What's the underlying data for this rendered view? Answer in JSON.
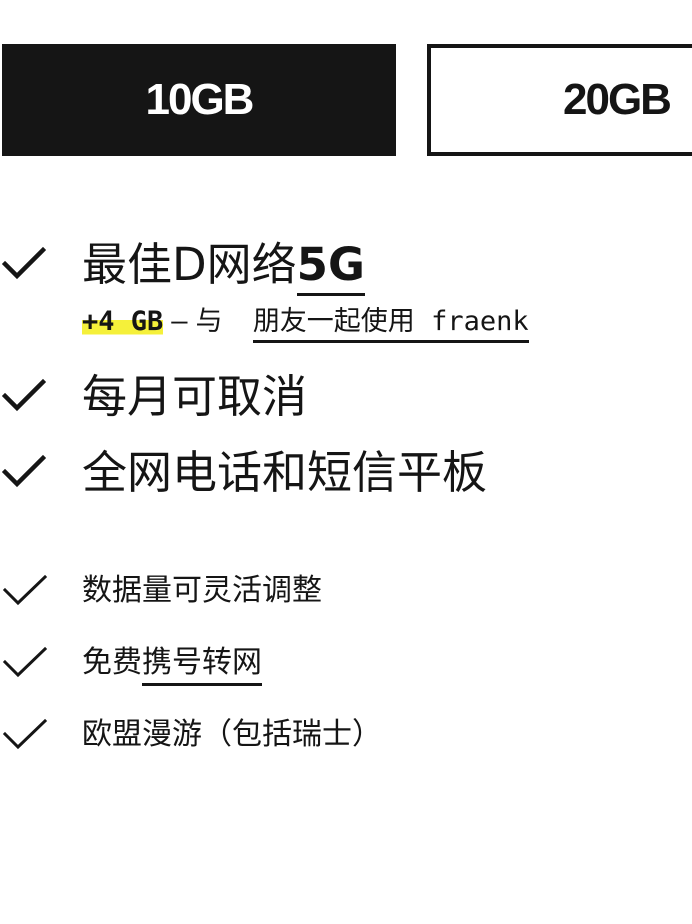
{
  "plans": {
    "options": [
      {
        "label": "10GB",
        "selected": true
      },
      {
        "label": "20GB",
        "selected": false
      }
    ]
  },
  "features": {
    "network_prefix": "最佳D网络",
    "network_link": "5G",
    "bonus_highlight": "+4 GB",
    "bonus_dash": "–",
    "bonus_with": "与",
    "bonus_link": "朋友一起使用 fraenk",
    "cancel_monthly": "每月可取消",
    "flat_rate": "全网电话和短信平板",
    "adjust_data": "数据量可灵活调整",
    "porting_prefix": "免费",
    "porting_link": "携号转网",
    "eu_roaming": "欧盟漫游（包括瑞士）"
  },
  "colors": {
    "text": "#151515",
    "selected_bg": "#151515",
    "highlight": "#f5f03a",
    "background": "#ffffff"
  },
  "icons": {
    "check": "check-icon"
  }
}
